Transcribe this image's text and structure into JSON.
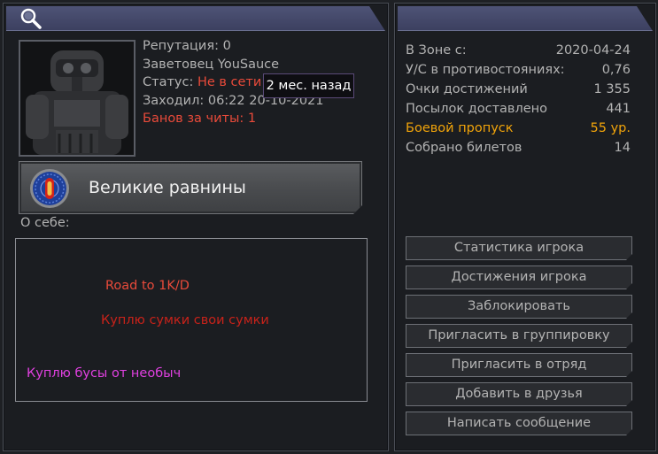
{
  "profile": {
    "reputation": "Репутация: 0",
    "title": "Заветовец YouSauce",
    "status_prefix": "Статус: ",
    "status_value": "Не в сети",
    "last_seen": "Заходил: 06:22 20-10-2021",
    "bans": "Банов за читы: 1",
    "tooltip": "2 мес. назад"
  },
  "location": {
    "label": "Великие равнины",
    "icon": "faction-emblem-icon"
  },
  "about": {
    "label": "О себе:",
    "lines": [
      "Road to 1K/D",
      "Куплю сумки свои сумки",
      "Куплю бусы от необыч"
    ]
  },
  "stats": [
    {
      "key": "В Зоне с:",
      "value": "2020-04-24"
    },
    {
      "key": "У/С в противостояниях:",
      "value": "0,76"
    },
    {
      "key": "Очки достижений",
      "value": "1 355"
    },
    {
      "key": "Посылок доставлено",
      "value": "441"
    },
    {
      "key": "Боевой пропуск",
      "value": "55 ур."
    },
    {
      "key": "Собрано билетов",
      "value": "14"
    }
  ],
  "actions": [
    "Статистика игрока",
    "Достижения игрока",
    "Заблокировать",
    "Пригласить в группировку",
    "Пригласить в отряд",
    "Добавить в друзья",
    "Написать сообщение"
  ],
  "colors": {
    "header": "#4e5376",
    "status_red": "#e84a3a",
    "battle_pass_gold": "#f0a30a",
    "about_line1": "#e84a3a",
    "about_line2": "#c8221a",
    "about_line3": "#e040e0"
  }
}
